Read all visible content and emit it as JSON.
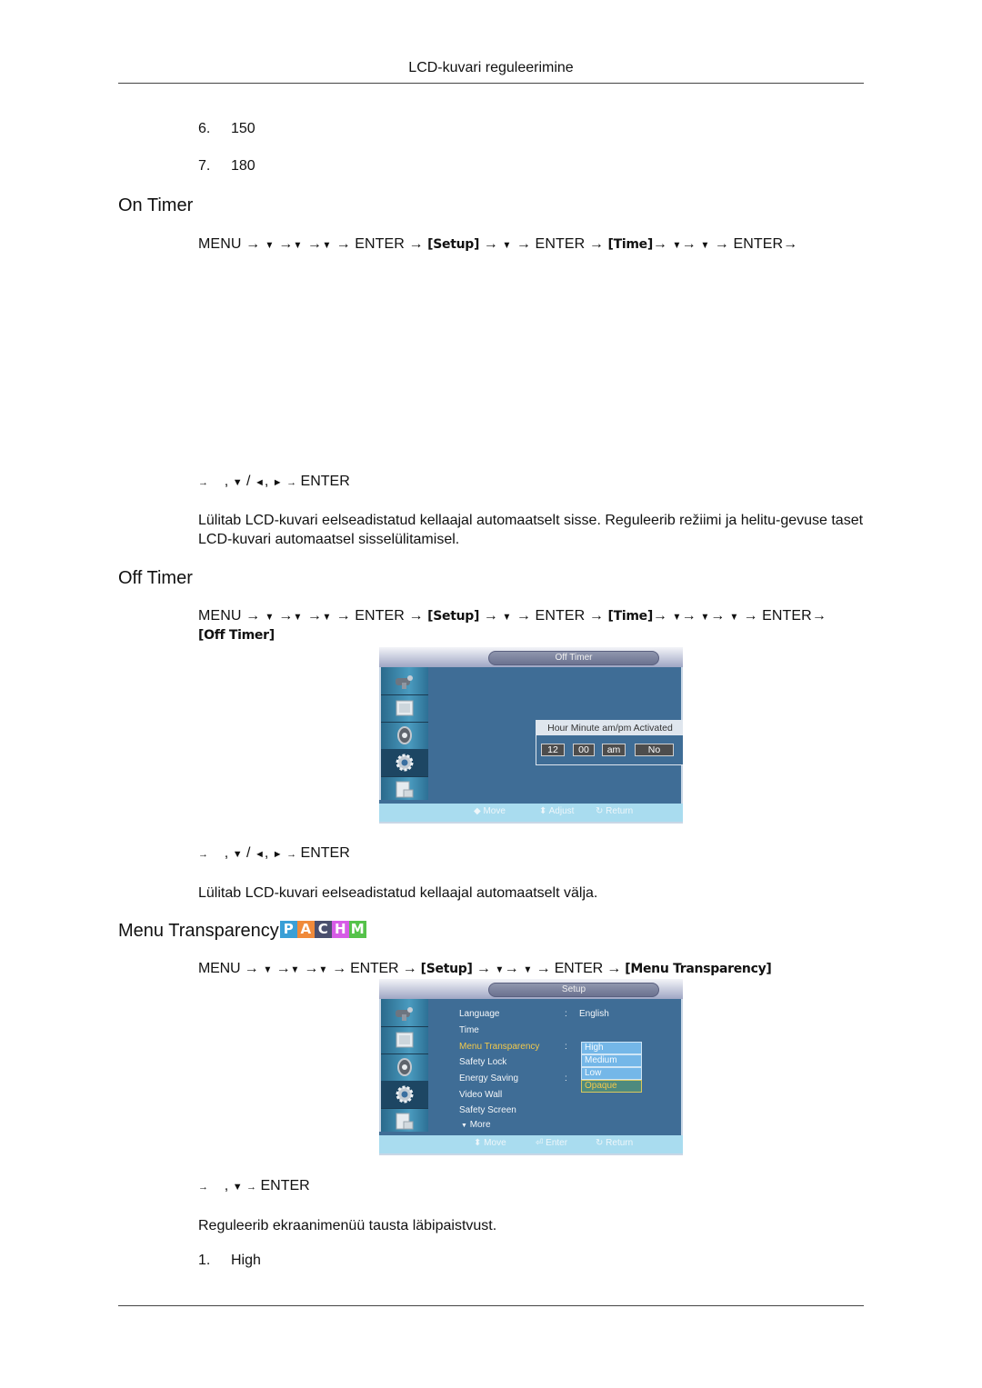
{
  "header": {
    "title": "LCD-kuvari reguleerimine"
  },
  "intro_list": [
    {
      "num": "6.",
      "text": "150"
    },
    {
      "num": "7.",
      "text": "180"
    }
  ],
  "sections": {
    "on_timer": {
      "title": "On Timer",
      "path": {
        "menu": "MENU",
        "arrow": "→",
        "down": "▼",
        "left": "◄",
        "right": "►",
        "enter": "ENTER",
        "setup": "[Setup]",
        "time": "[Time]"
      },
      "keys": {
        "prefix": "→",
        "sep": ",",
        "down": "▼",
        "slash": "/",
        "left": "◄",
        "right": "►",
        "enter": "ENTER"
      },
      "description": "Lülitab LCD-kuvari eelseadistatud kellaajal automaatselt sisse. Reguleerib režiimi ja helitu-gevuse taset LCD-kuvari automaatsel sisselülitamisel."
    },
    "off_timer": {
      "title": "Off Timer",
      "path_target": "[Off Timer]",
      "keys_text": "ENTER",
      "description": "Lülitab LCD-kuvari eelseadistatud kellaajal automaatselt välja.",
      "osd": {
        "title": "Off Timer",
        "headers": "Hour  Minute am/pm Activated",
        "hour": "12",
        "minute": "00",
        "ampm": "am",
        "activated": "No",
        "footer": {
          "move": "Move",
          "adjust": "Adjust",
          "return": "Return"
        }
      }
    },
    "menu_transparency": {
      "title": "Menu Transparency",
      "badges": [
        {
          "letter": "P",
          "color": "#3a9fd6"
        },
        {
          "letter": "A",
          "color": "#f08a3a"
        },
        {
          "letter": "C",
          "color": "#4a4f6e"
        },
        {
          "letter": "H",
          "color": "#d65ce6"
        },
        {
          "letter": "M",
          "color": "#55c24a"
        }
      ],
      "path_target": "[Menu Transparency]",
      "description": "Reguleerib ekraanimenüü tausta läbipaistvust.",
      "osd": {
        "title": "Setup",
        "rows": [
          "Language",
          "Time",
          "Menu Transparency",
          "Safety Lock",
          "Energy Saving",
          "Video Wall",
          "Safety Screen"
        ],
        "more": "More",
        "more_icon": "▼",
        "language_value": "English",
        "colon": ":",
        "options": [
          "High",
          "Medium",
          "Low",
          "Opaque"
        ],
        "footer": {
          "move": "Move",
          "enter": "Enter",
          "return": "Return"
        }
      },
      "list": [
        {
          "num": "1.",
          "text": "High"
        }
      ]
    }
  }
}
